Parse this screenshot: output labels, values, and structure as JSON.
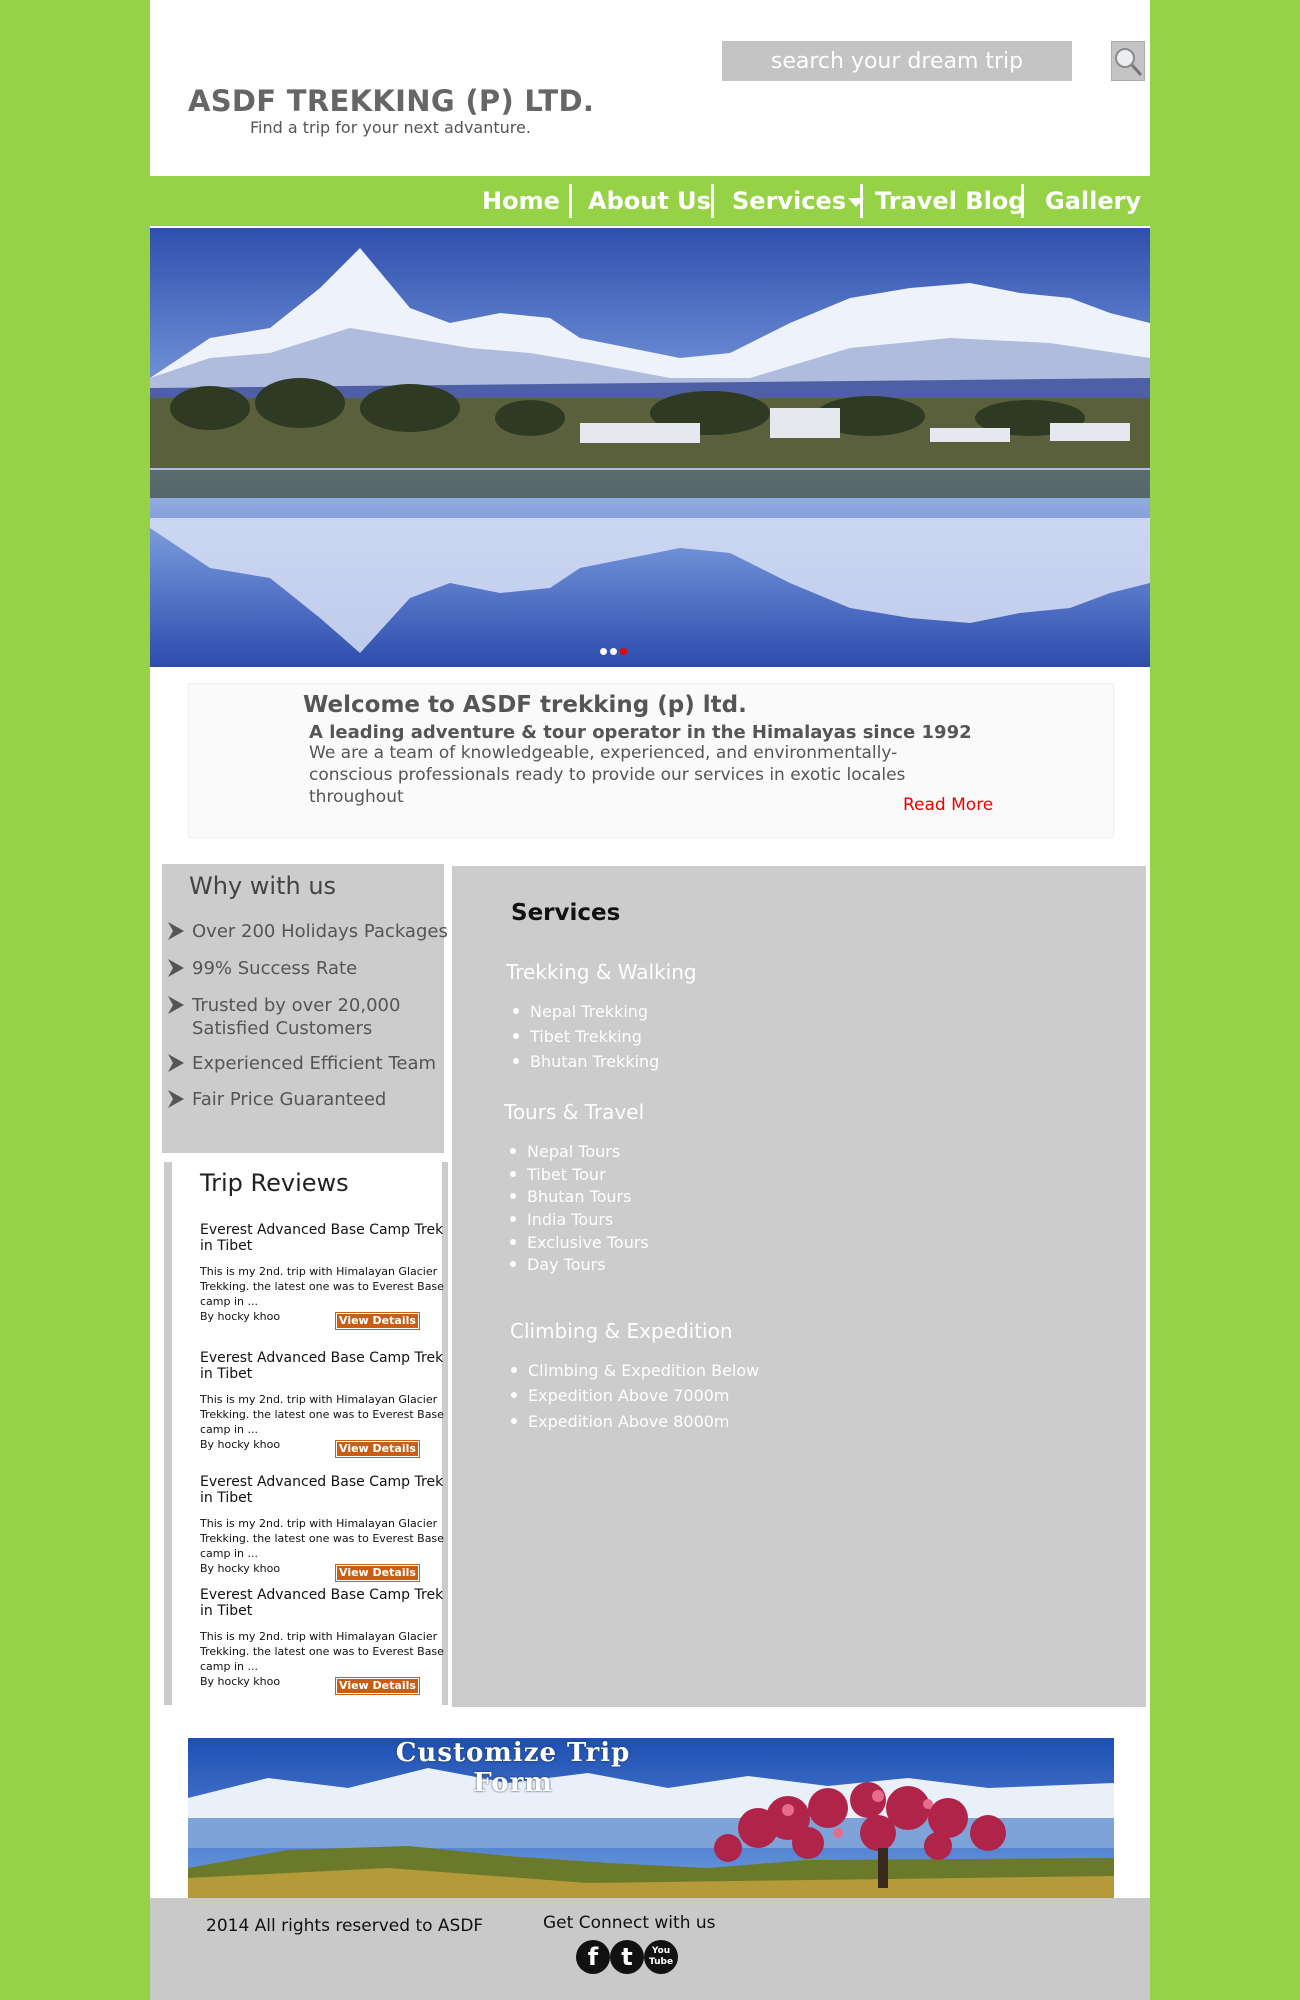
{
  "header": {
    "brand_title": "ASDF TREKKING (P) LTD.",
    "brand_tagline": "Find a trip for your next advanture.",
    "search_placeholder": "search your dream trip",
    "search_icon": "magnifier-icon"
  },
  "nav": {
    "items": [
      "Home",
      "About Us",
      "Services",
      "Travel Blog",
      "Gallery"
    ]
  },
  "hero": {
    "slide_count": 3,
    "active_slide": 3
  },
  "welcome": {
    "title": "Welcome to ASDF trekking (p) ltd.",
    "subtitle": "A leading adventure & tour operator in the Himalayas since 1992",
    "body": "We are a team of knowledgeable, experienced, and environmentally-conscious professionals ready to provide our services in exotic locales throughout",
    "read_more": "Read More"
  },
  "why": {
    "heading": "Why with us",
    "items": [
      "Over 200 Holidays Packages",
      "99% Success Rate",
      "Trusted by over 20,000 Satisfied Customers",
      "Experienced Efficient Team",
      "Fair Price Guaranteed"
    ]
  },
  "reviews": {
    "heading": "Trip Reviews",
    "items": [
      {
        "title": "Everest Advanced Base Camp Trek in Tibet",
        "body": "This is my 2nd. trip with Himalayan Glacier Trekking. the latest one was to Everest Base camp in ...",
        "author": "By hocky khoo",
        "button": "View Details"
      },
      {
        "title": "Everest Advanced Base Camp Trek in Tibet",
        "body": "This is my 2nd. trip with Himalayan Glacier Trekking. the latest one was to Everest Base camp in ...",
        "author": "By hocky khoo",
        "button": "View Details"
      },
      {
        "title": "Everest Advanced Base Camp Trek in Tibet",
        "body": "This is my 2nd. trip with Himalayan Glacier Trekking. the latest one was to Everest Base camp in ...",
        "author": "By hocky khoo",
        "button": "View Details"
      },
      {
        "title": "Everest Advanced Base Camp Trek in Tibet",
        "body": "This is my 2nd. trip with Himalayan Glacier Trekking. the latest one was to Everest Base camp in ...",
        "author": "By hocky khoo",
        "button": "View Details"
      }
    ]
  },
  "services": {
    "heading": "Services",
    "categories": [
      {
        "title": "Trekking & Walking",
        "items": [
          "Nepal Trekking",
          "Tibet Trekking",
          "Bhutan Trekking"
        ]
      },
      {
        "title": "Tours & Travel",
        "items": [
          "Nepal Tours",
          "Tibet Tour",
          "Bhutan Tours",
          "India Tours",
          "Exclusive Tours",
          "Day Tours"
        ]
      },
      {
        "title": "Climbing & Expedition",
        "items": [
          "Climbing & Expedition Below",
          "Expedition Above 7000m",
          "Expedition Above 8000m"
        ]
      }
    ]
  },
  "custom_banner": {
    "title_line1": "Customize Trip",
    "title_line2": "Form"
  },
  "footer": {
    "copyright": "2014 All rights reserved to ASDF",
    "connect": "Get Connect with us",
    "social": [
      {
        "icon": "facebook-icon",
        "glyph": "f"
      },
      {
        "icon": "twitter-icon",
        "glyph": "t"
      },
      {
        "icon": "youtube-icon",
        "glyph": "You Tube"
      }
    ]
  },
  "colors": {
    "background": "#96d246",
    "accent_red": "#ee0000",
    "view_details": "#c95e12",
    "panel_gray": "#cccccc"
  }
}
